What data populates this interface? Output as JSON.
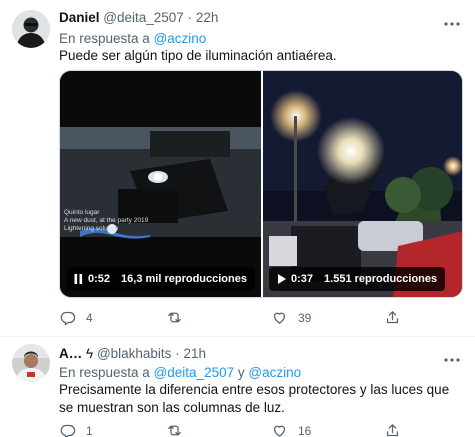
{
  "tweets": [
    {
      "name": "Daniel",
      "handle": "@deita_2507",
      "sep": "·",
      "time": "22h",
      "reply_prefix": "En respuesta a",
      "reply_mention": "@aczino",
      "text": "Puede ser algún tipo de iluminación antiaérea.",
      "media": [
        {
          "duration": "0:52",
          "views": "16,3 mil reproducciones",
          "caption_lines": [
            "Quinto lugar",
            "A new dust, at the party 2019",
            "Lightening solution"
          ]
        },
        {
          "duration": "0:37",
          "views": "1.551 reproducciones"
        }
      ],
      "reply_count": "4",
      "retweet_count": "",
      "like_count": "39"
    },
    {
      "name": "A…",
      "name_symbol": "ϟ",
      "handle": "@blakhabits",
      "sep": "·",
      "time": "21h",
      "reply_prefix": "En respuesta a",
      "reply_mention_1": "@deita_2507",
      "reply_joiner": "y",
      "reply_mention_2": "@aczino",
      "text": "Precisamente la diferencia entre esos protectores y las luces que se muestran son las columnas de luz.",
      "reply_count": "1",
      "retweet_count": "",
      "like_count": "16"
    }
  ],
  "colors": {
    "accent": "#1d9bf0",
    "secondary_text": "#536471",
    "primary_text": "#0f1419",
    "divider": "#eff3f4"
  },
  "icons": [
    "more-icon",
    "reply-icon",
    "retweet-icon",
    "like-icon",
    "share-icon",
    "pause-icon",
    "play-icon"
  ]
}
